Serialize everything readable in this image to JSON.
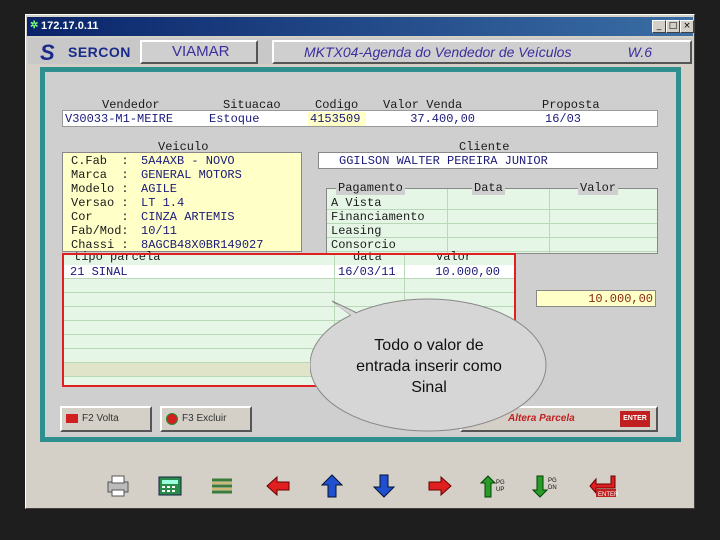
{
  "window": {
    "title": "172.17.0.11",
    "controls": [
      "_",
      "□",
      "×"
    ]
  },
  "header": {
    "brand": "SERCON",
    "company": "VIAMAR",
    "screen_title": "MKTX04-Agenda do Vendedor de Veículos",
    "version": "W.6"
  },
  "top_fields": {
    "headers": [
      "Vendedor",
      "Situacao",
      "Codigo",
      "Valor Venda",
      "Proposta"
    ],
    "values": [
      "V30033-M1-MEIRE",
      "Estoque",
      "4153509",
      "37.400,00",
      "16/03"
    ]
  },
  "veiculo": {
    "title": "Veiculo",
    "rows": [
      {
        "label": "C.Fab  :",
        "value": "5A4AXB - NOVO"
      },
      {
        "label": "Marca  :",
        "value": "GENERAL MOTORS"
      },
      {
        "label": "Modelo :",
        "value": "AGILE"
      },
      {
        "label": "Versao :",
        "value": "LT 1.4"
      },
      {
        "label": "Cor    :",
        "value": "CINZA ARTEMIS"
      },
      {
        "label": "Fab/Mod:",
        "value": "10/11"
      },
      {
        "label": "Chassi :",
        "value": "8AGCB48X0BR149027"
      }
    ]
  },
  "cliente": {
    "title": "Cliente",
    "name": "GGILSON WALTER PEREIRA JUNIOR"
  },
  "pagamento": {
    "headers": [
      "Pagamento",
      "Data",
      "Valor"
    ],
    "rows": [
      "A Vista",
      "Financiamento",
      "Leasing",
      "Consorcio"
    ],
    "total": "10.000,00"
  },
  "parcelas": {
    "headers": [
      "tipo parcela",
      "data",
      "valor"
    ],
    "rows": [
      {
        "tipo": "21 SINAL",
        "data": "16/03/11",
        "valor": "10.000,00"
      }
    ]
  },
  "bottom_buttons": {
    "volta": "F2 Volta",
    "excluir": "F3 Excluir",
    "altera": "Altera Parcela",
    "enter": "ENTER"
  },
  "callout": {
    "text": "Todo o valor de entrada inserir como Sinal"
  },
  "toolbar": {
    "icons": [
      "printer-icon",
      "calculator-icon",
      "list-icon",
      "arrow-left-icon",
      "arrow-up-icon",
      "arrow-down-icon",
      "arrow-right-icon",
      "pgup-icon",
      "pgdn-icon",
      "enter-icon"
    ],
    "pgup": "PG UP",
    "pgdn": "PG DN",
    "enter": "ENTER"
  },
  "colors": {
    "teal_border": "#2f8f8f",
    "red_highlight": "#e02020",
    "field_text": "#1a1a7a",
    "title_bar": "#0a246a"
  }
}
